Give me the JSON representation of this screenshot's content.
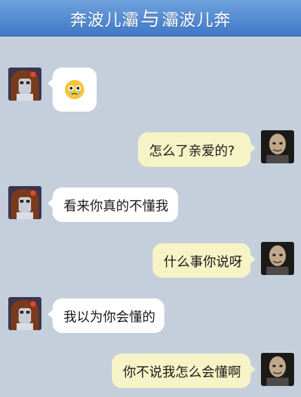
{
  "header": {
    "title_left": "奔波儿灞",
    "title_join": "与",
    "title_right": "灞波儿奔"
  },
  "messages": [
    {
      "side": "left",
      "type": "emoji",
      "icon": "crying-face-icon"
    },
    {
      "side": "right",
      "text": "怎么了亲爱的?"
    },
    {
      "side": "left",
      "text": "看来你真的不懂我"
    },
    {
      "side": "right",
      "text": "什么事你说呀"
    },
    {
      "side": "left",
      "text": "我以为你会懂的"
    },
    {
      "side": "right",
      "text": "你不说我怎么会懂啊"
    }
  ]
}
